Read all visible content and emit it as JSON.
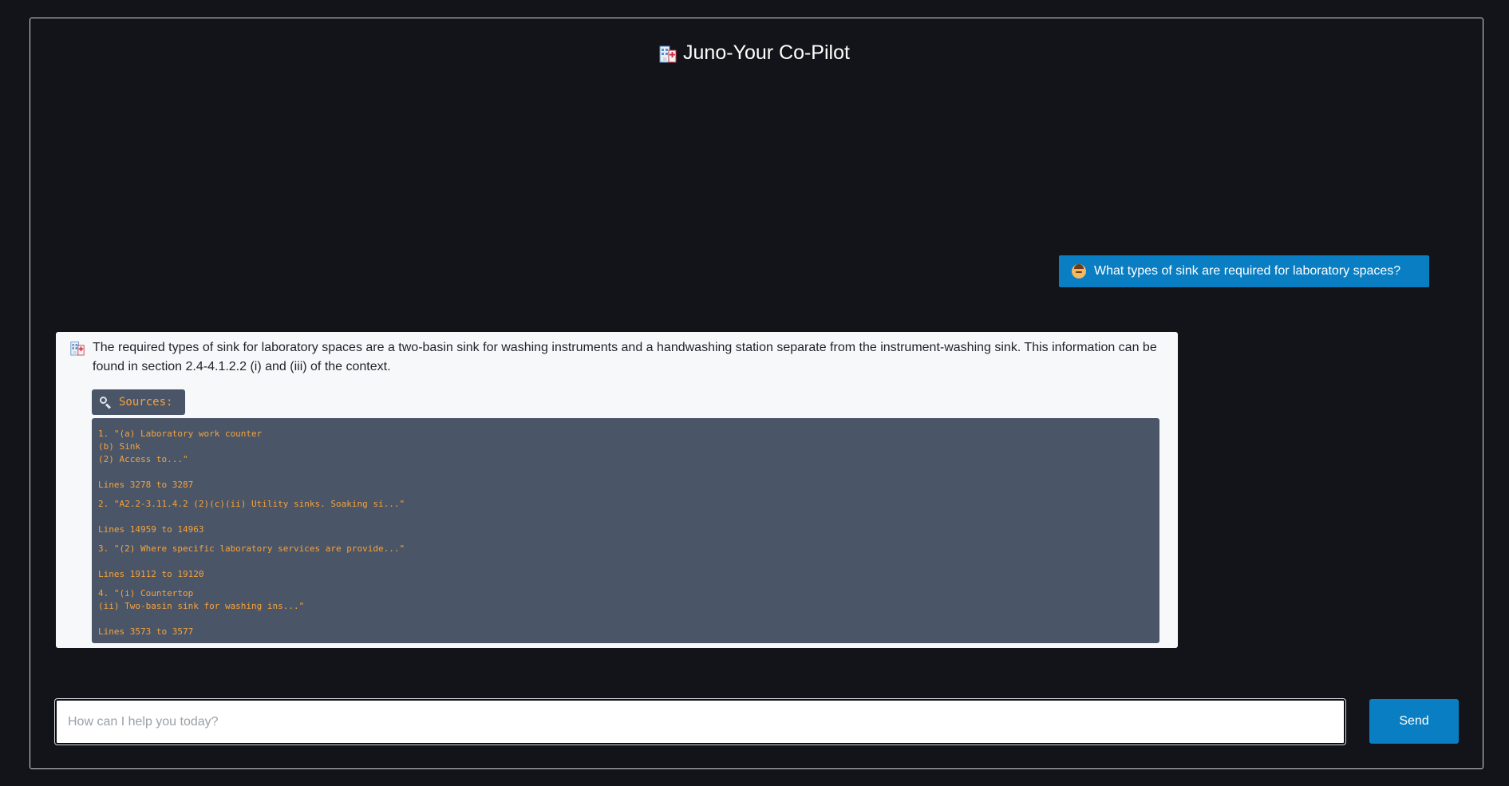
{
  "app": {
    "title": "Juno-Your Co-Pilot",
    "title_icon": "hospital-icon"
  },
  "conversation": {
    "user_message": {
      "avatar_icon": "person-icon",
      "text": "What types of sink are required for laboratory spaces?"
    },
    "bot_message": {
      "avatar_icon": "hospital-icon",
      "text": "The required types of sink for laboratory spaces are a two-basin sink for washing instruments and a handwashing station separate from the instrument-washing sink. This information can be found in section 2.4-4.1.2.2 (i) and (iii) of the context.",
      "sources_label": "Sources:",
      "sources_icon": "search-icon",
      "sources": [
        {
          "excerpt_lines": [
            "1. \"(a) Laboratory work counter",
            "(b) Sink",
            "(2) Access to...\""
          ],
          "lines": "Lines 3278 to 3287"
        },
        {
          "excerpt_lines": [
            "2. \"A2.2-3.11.4.2 (2)(c)(ii) Utility sinks. Soaking si...\""
          ],
          "lines": "Lines 14959 to 14963"
        },
        {
          "excerpt_lines": [
            "3. \"(2) Where specific laboratory services are provide...\""
          ],
          "lines": "Lines 19112 to 19120"
        },
        {
          "excerpt_lines": [
            "4. \"(i) Countertop",
            "(ii) Two-basin sink for washing ins...\""
          ],
          "lines": "Lines 3573 to 3577"
        }
      ]
    }
  },
  "composer": {
    "placeholder": "How can I help you today?",
    "value": "",
    "send_label": "Send"
  },
  "colors": {
    "background": "#131419",
    "accent": "#0a7ec2",
    "source_text": "#f6a33a",
    "source_bg": "#4a5568"
  }
}
